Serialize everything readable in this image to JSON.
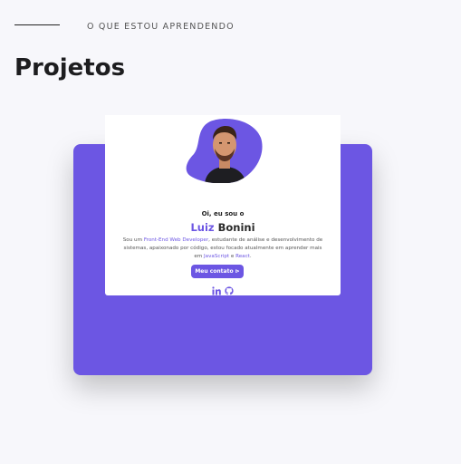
{
  "section": {
    "eyebrow": "O QUE ESTOU APRENDENDO",
    "title": "Projetos"
  },
  "project_preview": {
    "greeting": "Oi, eu sou o",
    "name_first": "Luiz",
    "name_last": "Bonini",
    "bio": {
      "p1": "Sou um ",
      "role": "Front-End Web Developer",
      "p2": ", estudante de análise e desenvolvimento de sistemas, apaixonado por código, estou focado atualmente em aprender mais em ",
      "tech1": "JavaScript",
      "p3": " e ",
      "tech2": "React",
      "p4": "."
    },
    "contact_button": "Meu contato ⊳",
    "socials": [
      "linkedin-icon",
      "github-icon"
    ]
  },
  "colors": {
    "accent": "#6c56e3",
    "background": "#f7f7fb",
    "text": "#1d1d1f"
  }
}
